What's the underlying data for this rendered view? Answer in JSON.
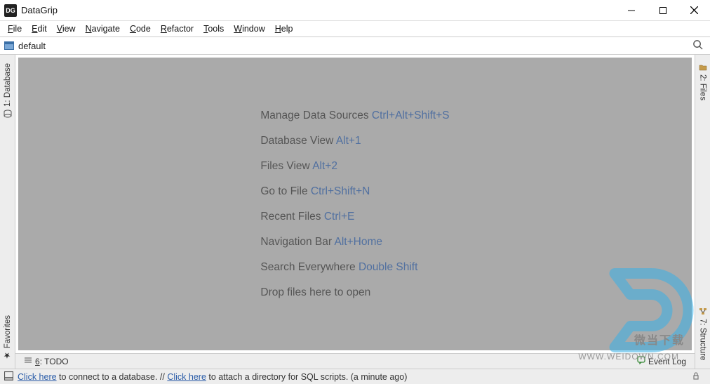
{
  "app": {
    "title": "DataGrip"
  },
  "menubar": [
    "File",
    "Edit",
    "View",
    "Navigate",
    "Code",
    "Refactor",
    "Tools",
    "Window",
    "Help"
  ],
  "navbar": {
    "project": "default"
  },
  "left_tools": {
    "database": "1: Database",
    "favorites": "Favorites"
  },
  "right_tools": {
    "files": "2: Files",
    "structure": "7: Structure"
  },
  "tips": [
    {
      "label": "Manage Data Sources",
      "shortcut": "Ctrl+Alt+Shift+S"
    },
    {
      "label": "Database View",
      "shortcut": "Alt+1"
    },
    {
      "label": "Files View",
      "shortcut": "Alt+2"
    },
    {
      "label": "Go to File",
      "shortcut": "Ctrl+Shift+N"
    },
    {
      "label": "Recent Files",
      "shortcut": "Ctrl+E"
    },
    {
      "label": "Navigation Bar",
      "shortcut": "Alt+Home"
    },
    {
      "label": "Search Everywhere",
      "shortcut": "Double Shift"
    },
    {
      "label": "Drop files here to open",
      "shortcut": ""
    }
  ],
  "bottom_tools": {
    "todo": "6: TODO",
    "event_log": "Event Log"
  },
  "statusbar": {
    "link1": "Click here",
    "text1": " to connect to a database. // ",
    "link2": "Click here",
    "text2": " to attach a directory for SQL scripts. (a minute ago)"
  },
  "watermark": {
    "cn": "微当下载",
    "url": "WWW.WEIDOWN.COM"
  }
}
